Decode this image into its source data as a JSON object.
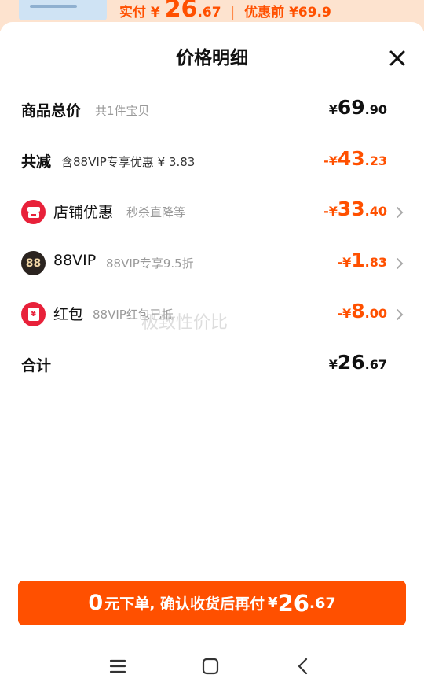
{
  "background_product": {
    "actual_label": "实付",
    "currency": "¥",
    "price_int": "26",
    "price_dec": ".67",
    "separator": "|",
    "original_label": "优惠前",
    "original_price": "¥69.9"
  },
  "sheet": {
    "title": "价格明细",
    "close_icon": "close-icon"
  },
  "rows": {
    "total": {
      "label": "商品总价",
      "sub": "共1件宝贝",
      "currency": "¥",
      "int": "69",
      "dec": ".90"
    },
    "reduced": {
      "label": "共减",
      "sub": "含88VIP专享优惠 ¥ 3.83",
      "prefix": "-¥",
      "int": "43",
      "dec": ".23"
    },
    "shop": {
      "label": "店铺优惠",
      "sub": "秒杀直降等",
      "prefix": "-¥",
      "int": "33",
      "dec": ".40",
      "icon": "store-discount-icon"
    },
    "vip": {
      "label": "88VIP",
      "sub": "88VIP专享9.5折",
      "prefix": "-¥",
      "int": "1",
      "dec": ".83",
      "icon": "88vip-icon",
      "icon_text": "88"
    },
    "redpacket": {
      "label": "红包",
      "sub": "88VIP红包已抵",
      "prefix": "-¥",
      "int": "8",
      "dec": ".00",
      "icon": "red-packet-icon",
      "icon_text": "¥"
    },
    "sum": {
      "label": "合计",
      "currency": "¥",
      "int": "26",
      "dec": ".67"
    }
  },
  "watermark": "极致性价比",
  "cta": {
    "zero": "0",
    "text": "元下单, 确认收货后再付",
    "currency": "¥",
    "int": "26",
    "dec": ".67"
  },
  "navbar": {
    "icons": [
      "menu-icon",
      "home-icon",
      "back-icon"
    ]
  },
  "colors": {
    "accent": "#ff5000",
    "text": "#111111",
    "muted": "#999999",
    "shop_icon": "#e8213a",
    "vip_icon": "#2b2420"
  }
}
